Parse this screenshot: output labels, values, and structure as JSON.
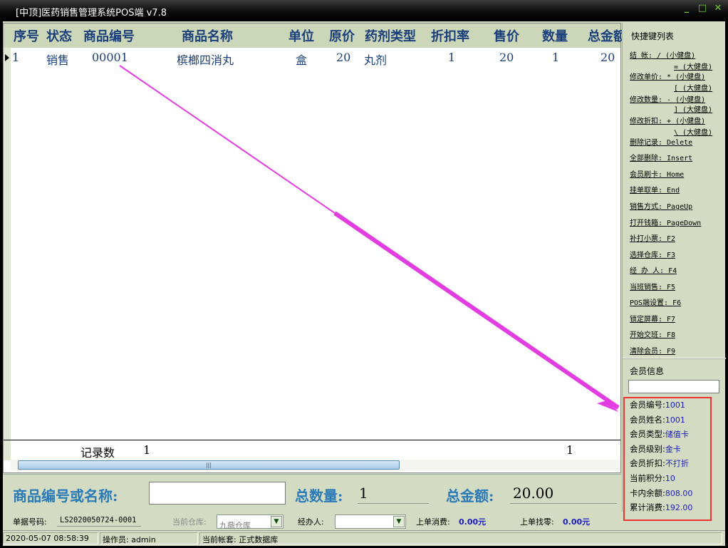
{
  "window": {
    "title": "[中顶]医药销售管理系统POS端 v7.8",
    "min": "_",
    "max": "□",
    "close": "✕"
  },
  "grid": {
    "columns": [
      "序号",
      "状态",
      "商品编号",
      "商品名称",
      "单位",
      "原价",
      "药剂类型",
      "折扣率",
      "售价",
      "数量",
      "总金额"
    ],
    "rows": [
      {
        "seq": "1",
        "status": "销售",
        "code": "00001",
        "name": "槟榔四消丸",
        "unit": "盒",
        "price": "20",
        "type": "丸剂",
        "discount": "1",
        "sale": "20",
        "qty": "1",
        "total": "20"
      }
    ],
    "footer": {
      "label": "记录数",
      "count": "1",
      "qty_sum": "1"
    }
  },
  "input_bar": {
    "code_label": "商品编号或名称:",
    "total_qty_label": "总数量:",
    "total_qty": "1",
    "total_amount_label": "总金额:",
    "total_amount": "20.00"
  },
  "status_bar": {
    "order_no_label": "单据号码:",
    "order_no": "LS2020050724-0001",
    "warehouse_label": "当前仓库:",
    "warehouse": "九鼎仓库",
    "handler_label": "经办人:",
    "last_spend_label": "上单消费:",
    "last_spend": "0.00元",
    "last_change_label": "上单找零:",
    "last_change": "0.00元"
  },
  "bottom_status": {
    "datetime": "2020-05-07 08:58:39",
    "operator": "操作员: admin",
    "account": "当前帐套: 正式数据库"
  },
  "shortcuts": {
    "title": "快捷键列表",
    "items": [
      {
        "label": "结    帐: / (小健盘)"
      },
      {
        "label": "= (大健盘)",
        "indent": true
      },
      {
        "label": "修改单价: * (小健盘)"
      },
      {
        "label": "[ (大健盘)",
        "indent": true
      },
      {
        "label": "修改数量: - (小健盘)"
      },
      {
        "label": "] (大健盘)",
        "indent": true
      },
      {
        "label": "修改折扣: + (小健盘)"
      },
      {
        "label": "\\ (大健盘)",
        "indent": true
      },
      {
        "label": "删除记录: Delete"
      },
      {
        "label": "全部删除: Insert"
      },
      {
        "label": "会员刷卡: Home"
      },
      {
        "label": "挂单取单: End"
      },
      {
        "label": "销售方式: PageUp"
      },
      {
        "label": "打开钱箱: PageDown"
      },
      {
        "label": "补打小票: F2"
      },
      {
        "label": "选择仓库: F3"
      },
      {
        "label": "经  办  人: F4"
      },
      {
        "label": "当班销售: F5"
      },
      {
        "label": "POS端设置: F6"
      },
      {
        "label": "锁定屏幕: F7"
      },
      {
        "label": "开始交班: F8"
      },
      {
        "label": "清除会员: F9"
      }
    ]
  },
  "member": {
    "title": "会员信息",
    "fields": [
      {
        "label": "会员编号:",
        "value": "1001"
      },
      {
        "label": "会员姓名:",
        "value": "1001"
      },
      {
        "label": "会员类型:",
        "value": "储值卡"
      },
      {
        "label": "会员级别:",
        "value": "金卡"
      },
      {
        "label": "会员折扣:",
        "value": "不打折"
      },
      {
        "label": "当前积分:",
        "value": "10"
      },
      {
        "label": "卡内余额:",
        "value": "808.00"
      },
      {
        "label": "累计消费:",
        "value": "192.00"
      }
    ]
  },
  "colors": {
    "accent": "#1a3f7a",
    "highlight_box": "#e33333",
    "arrow": "#e23de0"
  }
}
